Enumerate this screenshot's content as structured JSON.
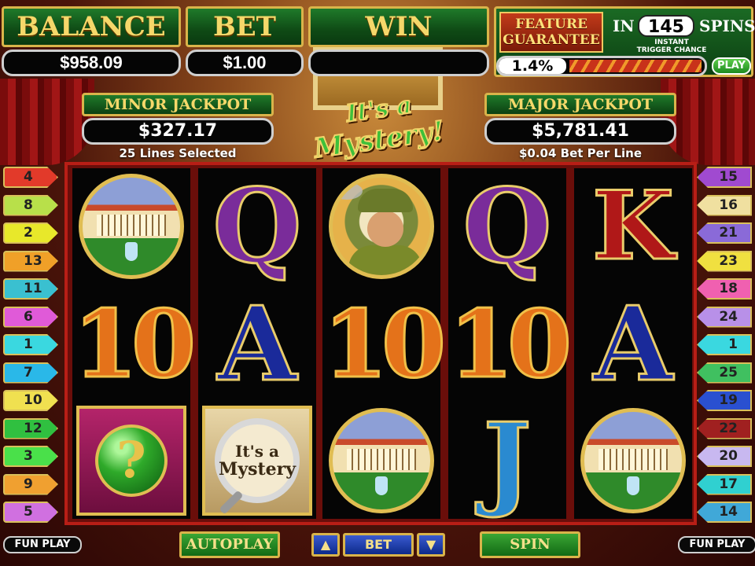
{
  "meters": {
    "balance": {
      "label": "BALANCE",
      "value": "$958.09"
    },
    "bet": {
      "label": "BET",
      "value": "$1.00"
    },
    "win": {
      "label": "WIN",
      "value": ""
    }
  },
  "feature": {
    "badge_line1": "FEATURE",
    "badge_line2": "GUARANTEE",
    "in_label": "IN",
    "spins_count": "145",
    "spins_label": "SPINS",
    "trigger_line1": "INSTANT",
    "trigger_line2": "TRIGGER CHANCE",
    "trigger_chance": "1.4%",
    "play_label": "PLAY"
  },
  "jackpots": {
    "minor": {
      "title": "MINOR JACKPOT",
      "value": "$327.17",
      "sub": "25 Lines Selected"
    },
    "major": {
      "title": "MAJOR JACKPOT",
      "value": "$5,781.41",
      "sub": "$0.04 Bet Per Line"
    }
  },
  "logo": {
    "line1": "It's a",
    "line2": "Mystery!"
  },
  "reels": [
    {
      "symbols": [
        "mansion",
        "10",
        "mystery-orb"
      ]
    },
    {
      "symbols": [
        "Q",
        "A",
        "magnifier-scatter"
      ]
    },
    {
      "symbols": [
        "detective",
        "10",
        "mansion"
      ]
    },
    {
      "symbols": [
        "Q",
        "10",
        "J"
      ]
    },
    {
      "symbols": [
        "K",
        "A",
        "mansion"
      ]
    }
  ],
  "scatter_text": {
    "line1": "It's a",
    "line2": "Mystery"
  },
  "lines_left": [
    {
      "num": "4",
      "color": "#e23a2a"
    },
    {
      "num": "8",
      "color": "#b8e04a"
    },
    {
      "num": "2",
      "color": "#e8e82a"
    },
    {
      "num": "13",
      "color": "#f0a028"
    },
    {
      "num": "11",
      "color": "#3ac0d0"
    },
    {
      "num": "6",
      "color": "#e05ad8"
    },
    {
      "num": "1",
      "color": "#3ad8e0"
    },
    {
      "num": "7",
      "color": "#2ab8e8"
    },
    {
      "num": "10",
      "color": "#f0e050"
    },
    {
      "num": "12",
      "color": "#30c040"
    },
    {
      "num": "3",
      "color": "#4ae04a"
    },
    {
      "num": "9",
      "color": "#f0a030"
    },
    {
      "num": "5",
      "color": "#d070e0"
    }
  ],
  "lines_right": [
    {
      "num": "15",
      "color": "#a04ad0"
    },
    {
      "num": "16",
      "color": "#f0e0a0"
    },
    {
      "num": "21",
      "color": "#8a6ad8"
    },
    {
      "num": "23",
      "color": "#f0e040"
    },
    {
      "num": "18",
      "color": "#f060b0"
    },
    {
      "num": "24",
      "color": "#b890e8"
    },
    {
      "num": "1",
      "color": "#3ad8e0"
    },
    {
      "num": "25",
      "color": "#40c060"
    },
    {
      "num": "19",
      "color": "#2a50d0"
    },
    {
      "num": "22",
      "color": "#a02020"
    },
    {
      "num": "20",
      "color": "#c8b8f0"
    },
    {
      "num": "17",
      "color": "#30d0d0"
    },
    {
      "num": "14",
      "color": "#40a8d8"
    }
  ],
  "controls": {
    "fun_play_left": "FUN PLAY",
    "autoplay": "AUTOPLAY",
    "bet_up": "▲",
    "bet": "BET",
    "bet_down": "▼",
    "spin": "SPIN",
    "fun_play_right": "FUN PLAY"
  }
}
